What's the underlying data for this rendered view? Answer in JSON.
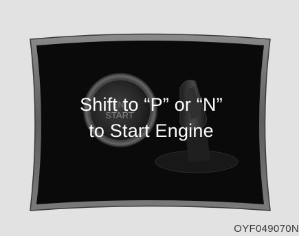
{
  "display": {
    "background_color": "#e2e2e2",
    "screen_color": "#0a0a0a",
    "bezel_color": "#6e6e6e",
    "message_color": "#ffffff",
    "button_icon": "engine-start-stop-button-icon",
    "shifter_icon": "gear-shift-lever-icon",
    "button_caption_top": "EN",
    "button_caption_bottom": "START"
  },
  "message": {
    "line1": "Shift to “P” or “N”",
    "line2": "to Start Engine"
  },
  "figure_code": "OYF049070N"
}
